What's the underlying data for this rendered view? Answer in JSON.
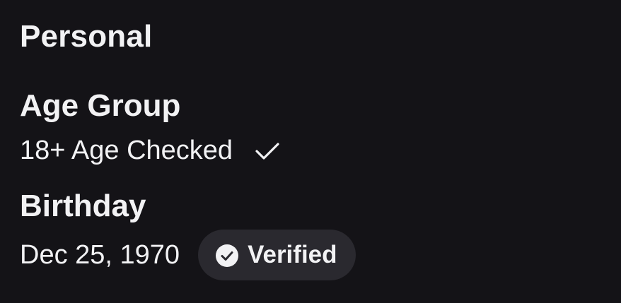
{
  "personal": {
    "section_title": "Personal",
    "age_group": {
      "label": "Age Group",
      "value": "18+ Age Checked",
      "icon": "checkmark-icon"
    },
    "birthday": {
      "label": "Birthday",
      "value": "Dec 25, 1970",
      "badge": {
        "label": "Verified",
        "icon": "check-circle-icon"
      }
    }
  },
  "colors": {
    "background": "#141317",
    "text": "#f2f2f4",
    "badge_background": "#2a292f"
  }
}
